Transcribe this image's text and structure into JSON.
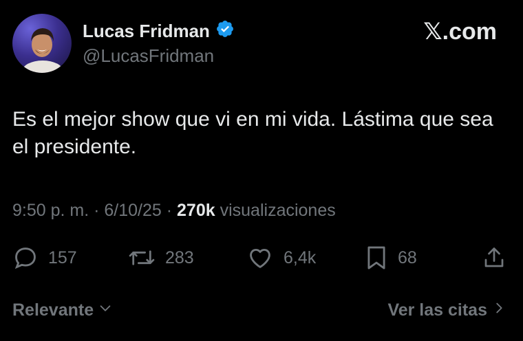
{
  "author": {
    "name": "Lucas Fridman",
    "handle": "@LucasFridman",
    "verified": true,
    "verified_color": "#1d9bf0"
  },
  "brand": {
    "x_glyph": "𝕏",
    "label": ".com"
  },
  "tweet": {
    "text": "Es el mejor show que vi en mi vida. Lástima que sea el presidente."
  },
  "meta": {
    "time": "9:50 p. m.",
    "sep1": " · ",
    "date": "6/10/25",
    "sep2": " · ",
    "views": "270k",
    "views_label": " visualizaciones"
  },
  "actions": {
    "replies": "157",
    "reposts": "283",
    "likes": "6,4k",
    "bookmarks": "68"
  },
  "footer": {
    "sort_label": "Relevante",
    "quotes_label": "Ver las citas"
  },
  "icons": [
    "verified-icon",
    "reply-icon",
    "repost-icon",
    "like-icon",
    "bookmark-icon",
    "share-icon",
    "chevron-down-icon",
    "chevron-right-icon"
  ]
}
